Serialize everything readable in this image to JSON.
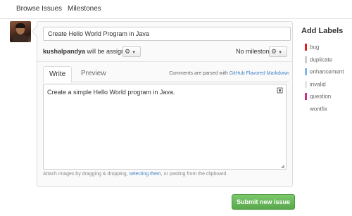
{
  "nav": {
    "browse_issues": "Browse Issues",
    "milestones": "Milestones"
  },
  "issue": {
    "title": "Create Hello World Program in Java",
    "assignee_user": "kushalpandya",
    "assignee_suffix": " will be assigned",
    "milestone": "No milestone",
    "body": "Create a simple Hello World program in Java."
  },
  "editor": {
    "write_tab": "Write",
    "preview_tab": "Preview",
    "md_note_prefix": "Comments are parsed with ",
    "md_note_link": "GitHub Flavored Markdown",
    "hint_prefix": "Attach images by dragging & dropping, ",
    "hint_link": "selecting them",
    "hint_suffix": ", or pasting from the clipboard."
  },
  "submit_label": "Submit new issue",
  "labels_panel": {
    "title": "Add Labels",
    "labels": [
      {
        "name": "bug",
        "color": "#e11d21"
      },
      {
        "name": "duplicate",
        "color": "#cccccc"
      },
      {
        "name": "enhancement",
        "color": "#84b6eb"
      },
      {
        "name": "invalid",
        "color": "#e6e6e6"
      },
      {
        "name": "question",
        "color": "#cc317c"
      },
      {
        "name": "wontfix",
        "color": "#ffffff"
      }
    ]
  }
}
